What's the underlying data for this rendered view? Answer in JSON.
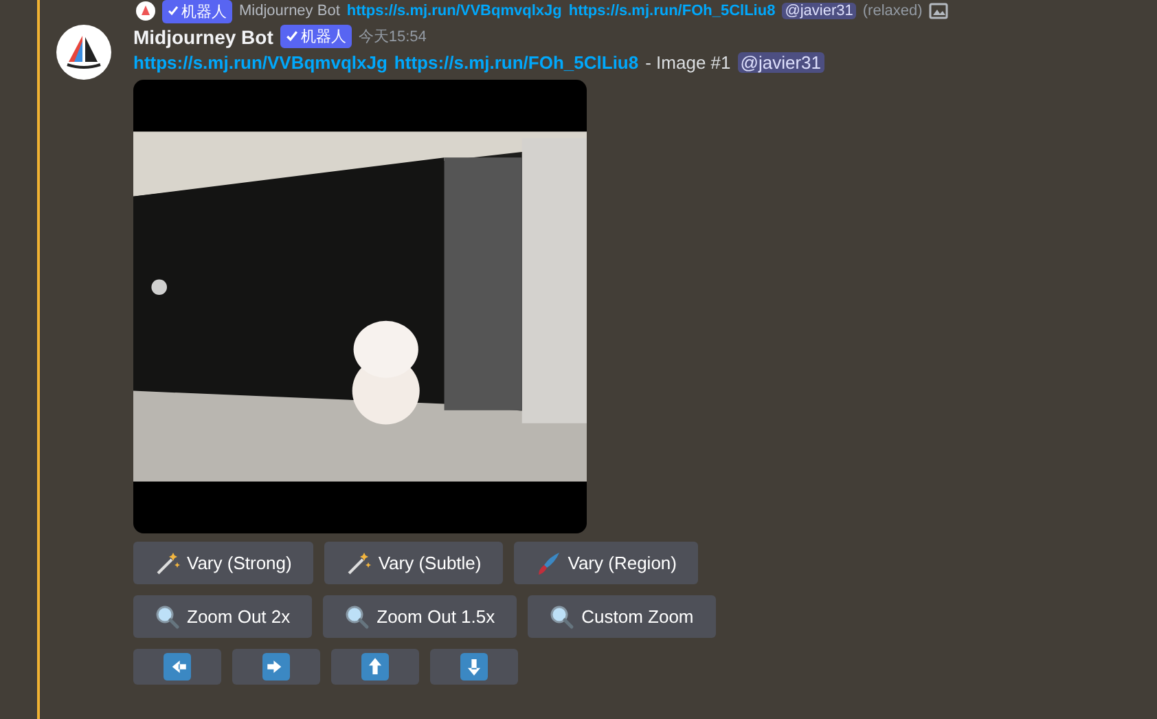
{
  "reply": {
    "author": "Midjourney Bot",
    "badge": "机器人",
    "links": [
      "https://s.mj.run/VVBqmvqlxJg",
      "https://s.mj.run/FOh_5ClLiu8"
    ],
    "mention": "@javier31",
    "suffix": "(relaxed)"
  },
  "message": {
    "author": "Midjourney Bot",
    "badge": "机器人",
    "timestamp": "今天15:54",
    "links": [
      "https://s.mj.run/VVBqmvqlxJg",
      "https://s.mj.run/FOh_5ClLiu8"
    ],
    "text": "- Image #1",
    "mention": "@javier31"
  },
  "button_rows": [
    [
      {
        "kind": "wand",
        "label": "Vary (Strong)"
      },
      {
        "kind": "wand",
        "label": "Vary (Subtle)"
      },
      {
        "kind": "brush",
        "label": "Vary (Region)"
      }
    ],
    [
      {
        "kind": "zoom",
        "label": "Zoom Out 2x"
      },
      {
        "kind": "zoom",
        "label": "Zoom Out 1.5x"
      },
      {
        "kind": "zoom",
        "label": "Custom Zoom"
      }
    ],
    [
      {
        "kind": "left"
      },
      {
        "kind": "right"
      },
      {
        "kind": "up"
      },
      {
        "kind": "down"
      }
    ]
  ]
}
